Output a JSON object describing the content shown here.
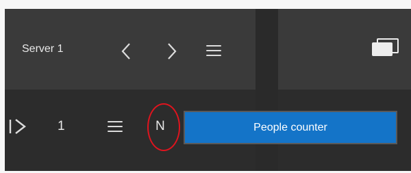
{
  "toolbar_top": {
    "server_name": "Server 1",
    "prev_icon": "chevron-left-icon",
    "next_icon": "chevron-right-icon",
    "menu_icon": "hamburger-icon",
    "layout_icon": "windows-icon"
  },
  "toolbar_bottom": {
    "play_icon": "play-step-icon",
    "page_number": "1",
    "menu_icon": "hamburger-icon",
    "n_label": "N",
    "people_counter_label": "People counter"
  },
  "colors": {
    "panel_dark": "#2d2d2d",
    "panel_mid": "#3a3a3a",
    "accent_blue": "#1474c8",
    "highlight_red": "#e0141e",
    "text": "#e9e9e9"
  }
}
